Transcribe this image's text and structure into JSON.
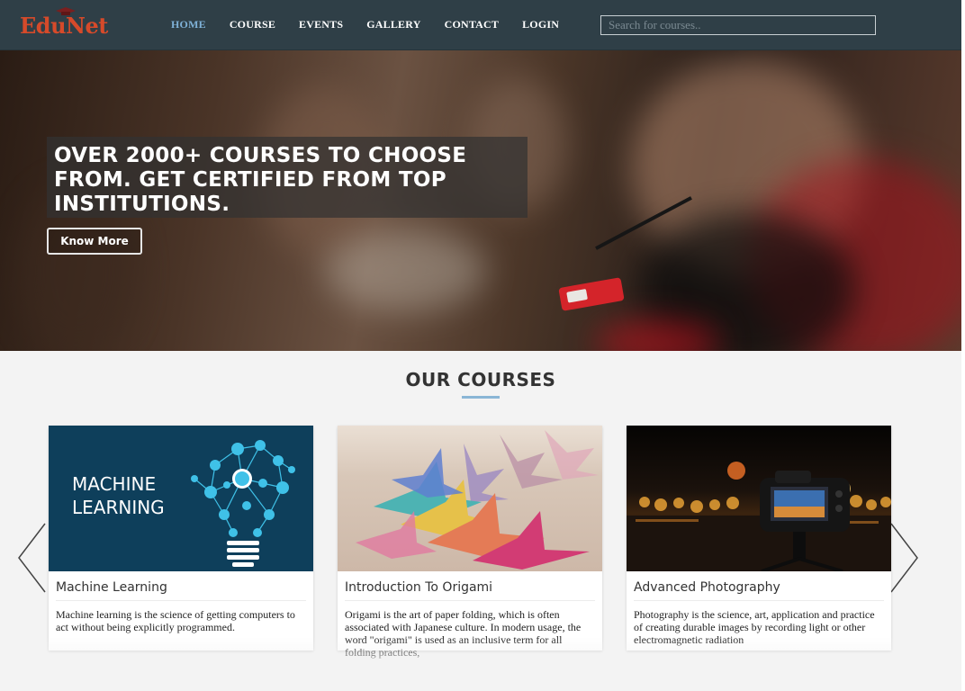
{
  "brand": {
    "logo_text": "EduNet"
  },
  "nav": {
    "items": [
      {
        "label": "HOME",
        "active": true
      },
      {
        "label": "COURSE",
        "active": false
      },
      {
        "label": "EVENTS",
        "active": false
      },
      {
        "label": "GALLERY",
        "active": false
      },
      {
        "label": "CONTACT",
        "active": false
      },
      {
        "label": "LOGIN",
        "active": false
      }
    ],
    "search_placeholder": "Search for courses.."
  },
  "hero": {
    "caption": "OVER 2000+ COURSES TO CHOOSE FROM. GET CERTIFIED FROM TOP INSTITUTIONS.",
    "button_label": "Know More"
  },
  "courses": {
    "title": "OUR COURSES",
    "cards": [
      {
        "thumb_text_line1": "MACHINE",
        "thumb_text_line2": "LEARNING",
        "title": "Machine Learning",
        "description": "Machine learning is the science of getting computers to act without being explicitly programmed."
      },
      {
        "title": "Introduction To Origami",
        "description": "Origami is the art of paper folding, which is often associated with Japanese culture. In modern usage, the word \"origami\" is used as an inclusive term for all folding practices,"
      },
      {
        "title": "Advanced Photography",
        "description": "Photography is the science, art, application and practice of creating durable images by recording light or other electromagnetic radiation"
      }
    ]
  },
  "colors": {
    "navbar": "#2f3f47",
    "logo": "#d64a2a",
    "nav_active": "#7fb2d8",
    "accent_underline": "#8ab6d6"
  }
}
